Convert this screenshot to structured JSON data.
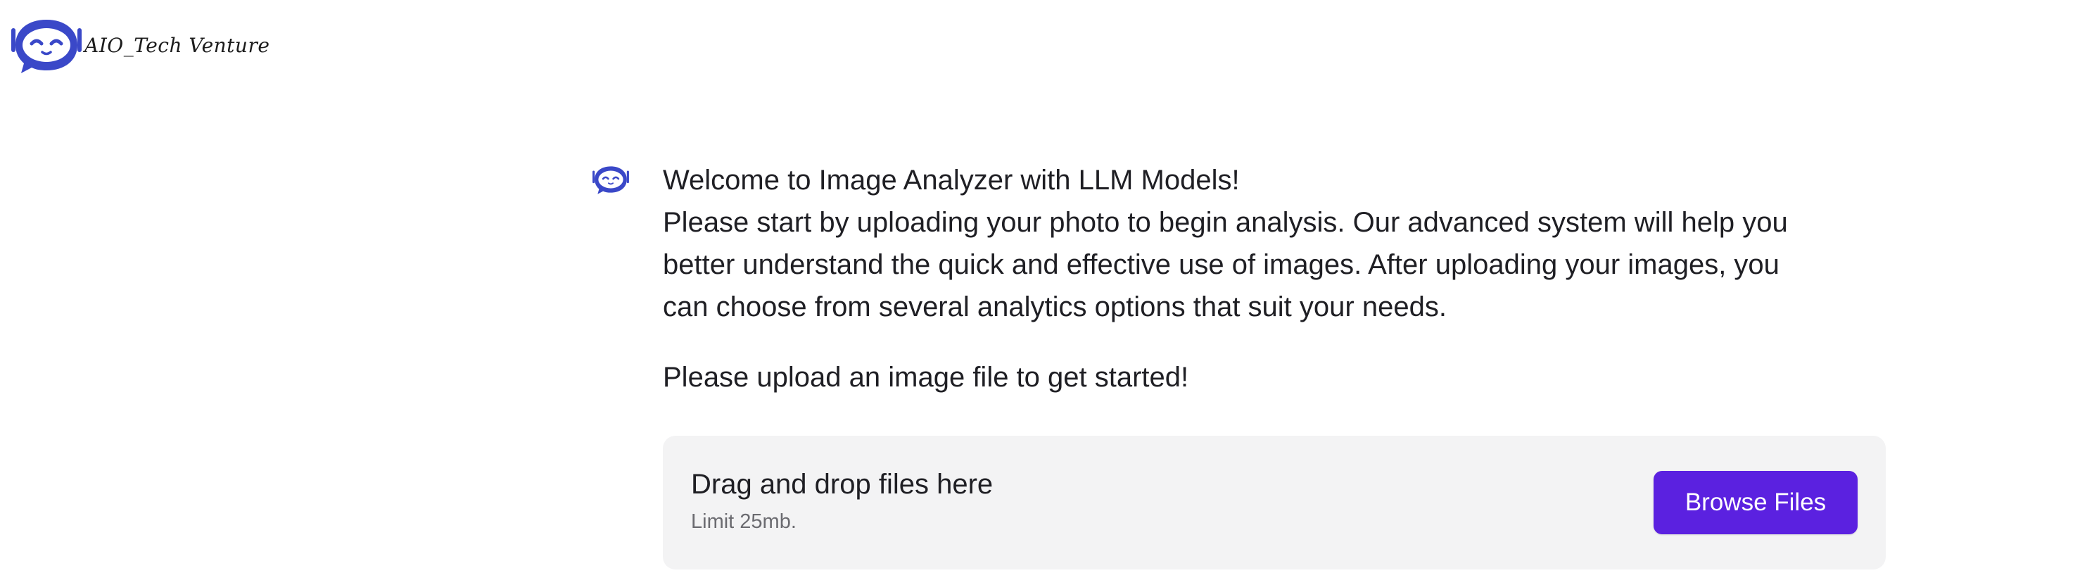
{
  "brand": {
    "name": "AIO_Tech Venture",
    "logo_icon": "robot-chat-icon",
    "logo_color": "#3a48c8"
  },
  "message": {
    "avatar_icon": "robot-chat-icon",
    "intro_lines": [
      "Welcome to Image Analyzer with LLM Models!",
      "Please start by uploading your photo to begin analysis. Our advanced system will help you",
      "better understand the quick and effective use of images. After uploading your images, you",
      "can choose from several analytics options that suit your needs."
    ],
    "prompt": "Please upload an image file to get started!"
  },
  "uploader": {
    "title": "Drag and drop files here",
    "limit": "Limit 25mb.",
    "browse_label": "Browse Files",
    "button_color": "#5b21e0"
  }
}
